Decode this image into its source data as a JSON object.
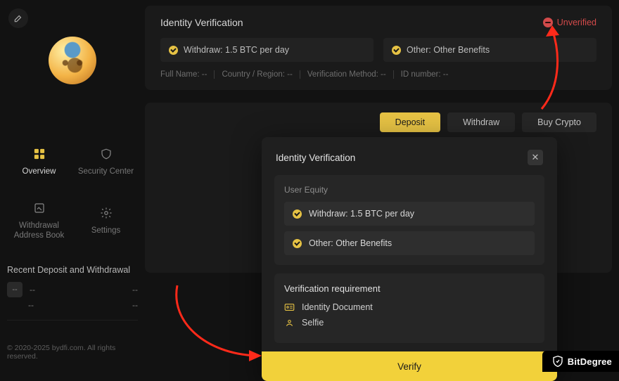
{
  "identity": {
    "title": "Identity Verification",
    "status": "Unverified",
    "benefits": {
      "withdraw": "Withdraw: 1.5 BTC per day",
      "other": "Other: Other Benefits"
    },
    "fields": {
      "name": "Full Name: --",
      "region": "Country / Region: --",
      "method": "Verification Method: --",
      "idnum": "ID number: --"
    }
  },
  "tabs": {
    "deposit": "Deposit",
    "withdraw": "Withdraw",
    "buy": "Buy Crypto"
  },
  "nav": {
    "overview": "Overview",
    "security": "Security Center",
    "address": "Withdrawal Address Book",
    "settings": "Settings"
  },
  "recent": {
    "title": "Recent Deposit and Withdrawal",
    "placeholder": "--"
  },
  "footer": {
    "copyright": "© 2020-2025 bydfi.com. All rights reserved."
  },
  "modal": {
    "title": "Identity Verification",
    "equity_label": "User Equity",
    "equity": {
      "withdraw": "Withdraw: 1.5 BTC per day",
      "other": "Other: Other Benefits"
    },
    "req_title": "Verification requirement",
    "req": {
      "doc": "Identity Document",
      "selfie": "Selfie"
    },
    "cta": "Verify"
  },
  "watermark": "BitDegree"
}
